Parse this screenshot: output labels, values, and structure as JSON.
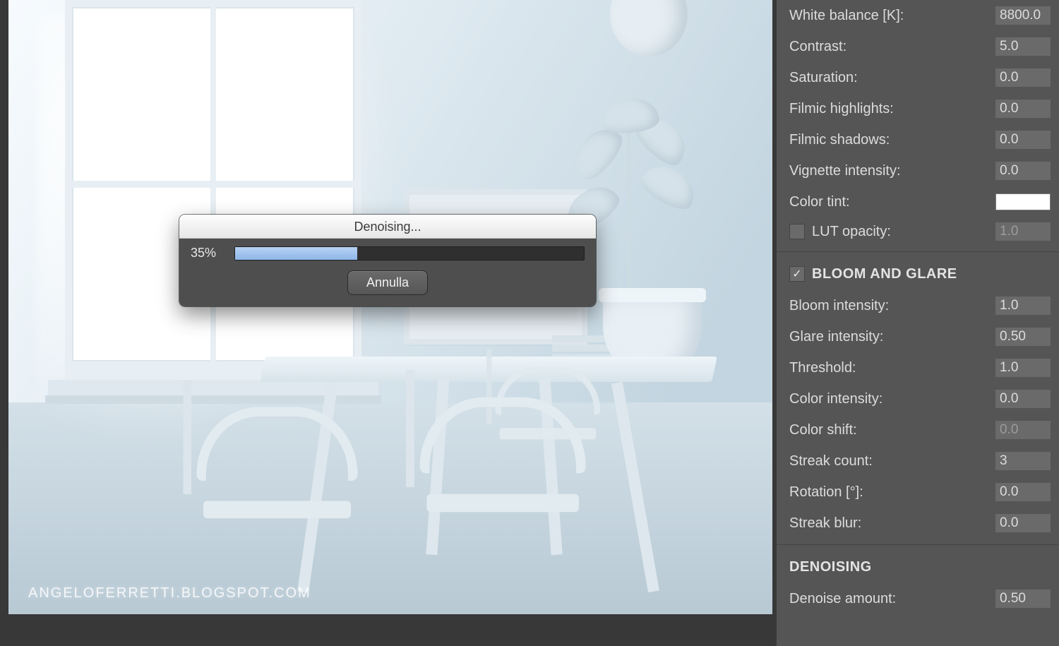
{
  "viewport": {
    "watermark": "ANGELOFERRETTI.BLOGSPOT.COM"
  },
  "dialog": {
    "title": "Denoising...",
    "percent_label": "35%",
    "percent_value": 35,
    "cancel_label": "Annulla"
  },
  "panel": {
    "params_top": [
      {
        "key": "white_balance",
        "label": "White balance [K]:",
        "value": "8800.0"
      },
      {
        "key": "contrast",
        "label": "Contrast:",
        "value": "5.0"
      },
      {
        "key": "saturation",
        "label": "Saturation:",
        "value": "0.0"
      },
      {
        "key": "filmic_highlights",
        "label": "Filmic highlights:",
        "value": "0.0"
      },
      {
        "key": "filmic_shadows",
        "label": "Filmic shadows:",
        "value": "0.0"
      },
      {
        "key": "vignette_intensity",
        "label": "Vignette intensity:",
        "value": "0.0"
      }
    ],
    "color_tint": {
      "label": "Color tint:",
      "swatch": "#ffffff"
    },
    "lut_opacity": {
      "label": "LUT opacity:",
      "value": "1.0",
      "checked": false
    },
    "bloom_section": {
      "title": "BLOOM AND GLARE",
      "checked": true,
      "params": [
        {
          "key": "bloom_intensity",
          "label": "Bloom intensity:",
          "value": "1.0"
        },
        {
          "key": "glare_intensity",
          "label": "Glare intensity:",
          "value": "0.50"
        },
        {
          "key": "threshold",
          "label": "Threshold:",
          "value": "1.0"
        },
        {
          "key": "color_intensity",
          "label": "Color intensity:",
          "value": "0.0"
        },
        {
          "key": "color_shift",
          "label": "Color shift:",
          "value": "0.0",
          "disabled": true
        },
        {
          "key": "streak_count",
          "label": "Streak count:",
          "value": "3"
        },
        {
          "key": "rotation",
          "label": "Rotation [°]:",
          "value": "0.0"
        },
        {
          "key": "streak_blur",
          "label": "Streak blur:",
          "value": "0.0"
        }
      ]
    },
    "denoising_section": {
      "title": "DENOISING",
      "params": [
        {
          "key": "denoise_amount",
          "label": "Denoise amount:",
          "value": "0.50"
        }
      ]
    }
  }
}
